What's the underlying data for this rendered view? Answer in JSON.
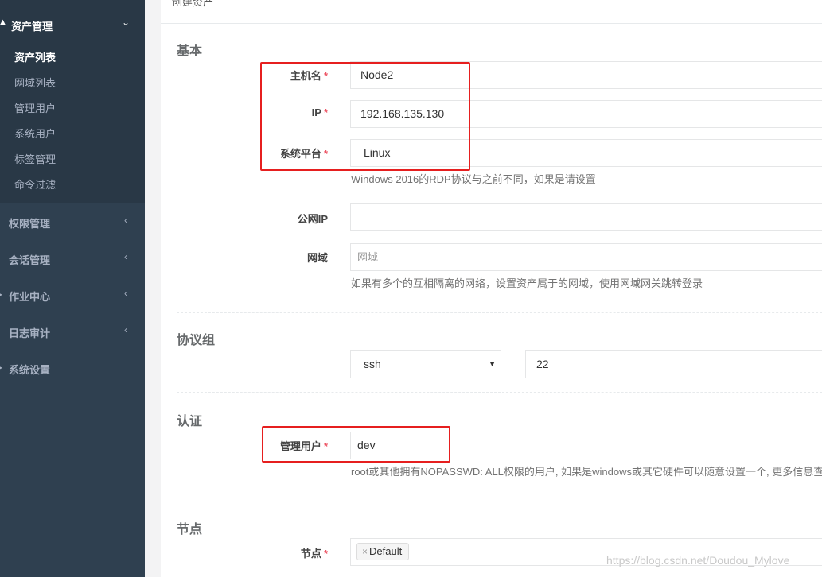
{
  "sidebar": {
    "asset_menu": {
      "label": "资产管理",
      "chevron": "⌄"
    },
    "asset_items": [
      "资产列表",
      "网域列表",
      "管理用户",
      "系统用户",
      "标签管理",
      "命令过滤"
    ],
    "menus": [
      {
        "label": "权限管理",
        "chevron": "‹"
      },
      {
        "label": "会话管理",
        "chevron": "‹"
      },
      {
        "label": "作业中心",
        "chevron": "‹"
      },
      {
        "label": "日志审计",
        "chevron": "‹"
      },
      {
        "label": "系统设置",
        "chevron": ""
      }
    ]
  },
  "panel": {
    "title": "创建资产"
  },
  "sections": {
    "basic": "基本",
    "protocol": "协议组",
    "auth": "认证",
    "node": "节点"
  },
  "fields": {
    "hostname": {
      "label": "主机名",
      "required": "*",
      "value": "Node2"
    },
    "ip": {
      "label": "IP",
      "required": "*",
      "value": "192.168.135.130"
    },
    "platform": {
      "label": "系统平台",
      "required": "*",
      "value": "Linux",
      "help": "Windows 2016的RDP协议与之前不同，如果是请设置"
    },
    "public_ip": {
      "label": "公网IP",
      "value": ""
    },
    "domain": {
      "label": "网域",
      "placeholder": "网域",
      "help": "如果有多个的互相隔离的网络，设置资产属于的网域，使用网域网关跳转登录"
    },
    "protocol": {
      "value": "ssh",
      "port": "22"
    },
    "admin_user": {
      "label": "管理用户",
      "required": "*",
      "value": "dev",
      "help": "root或其他拥有NOPASSWD: ALL权限的用户, 如果是windows或其它硬件可以随意设置一个, 更多信息查"
    },
    "nodes": {
      "label": "节点",
      "required": "*",
      "tag_remove": "×",
      "tag": "Default"
    }
  },
  "watermark": "https://blog.csdn.net/Doudou_Mylove",
  "colors": {
    "sidebar_bg": "#2f4050",
    "sidebar_active_bg": "#293846",
    "required": "#ed5565",
    "highlight_box": "#e61f1f"
  }
}
